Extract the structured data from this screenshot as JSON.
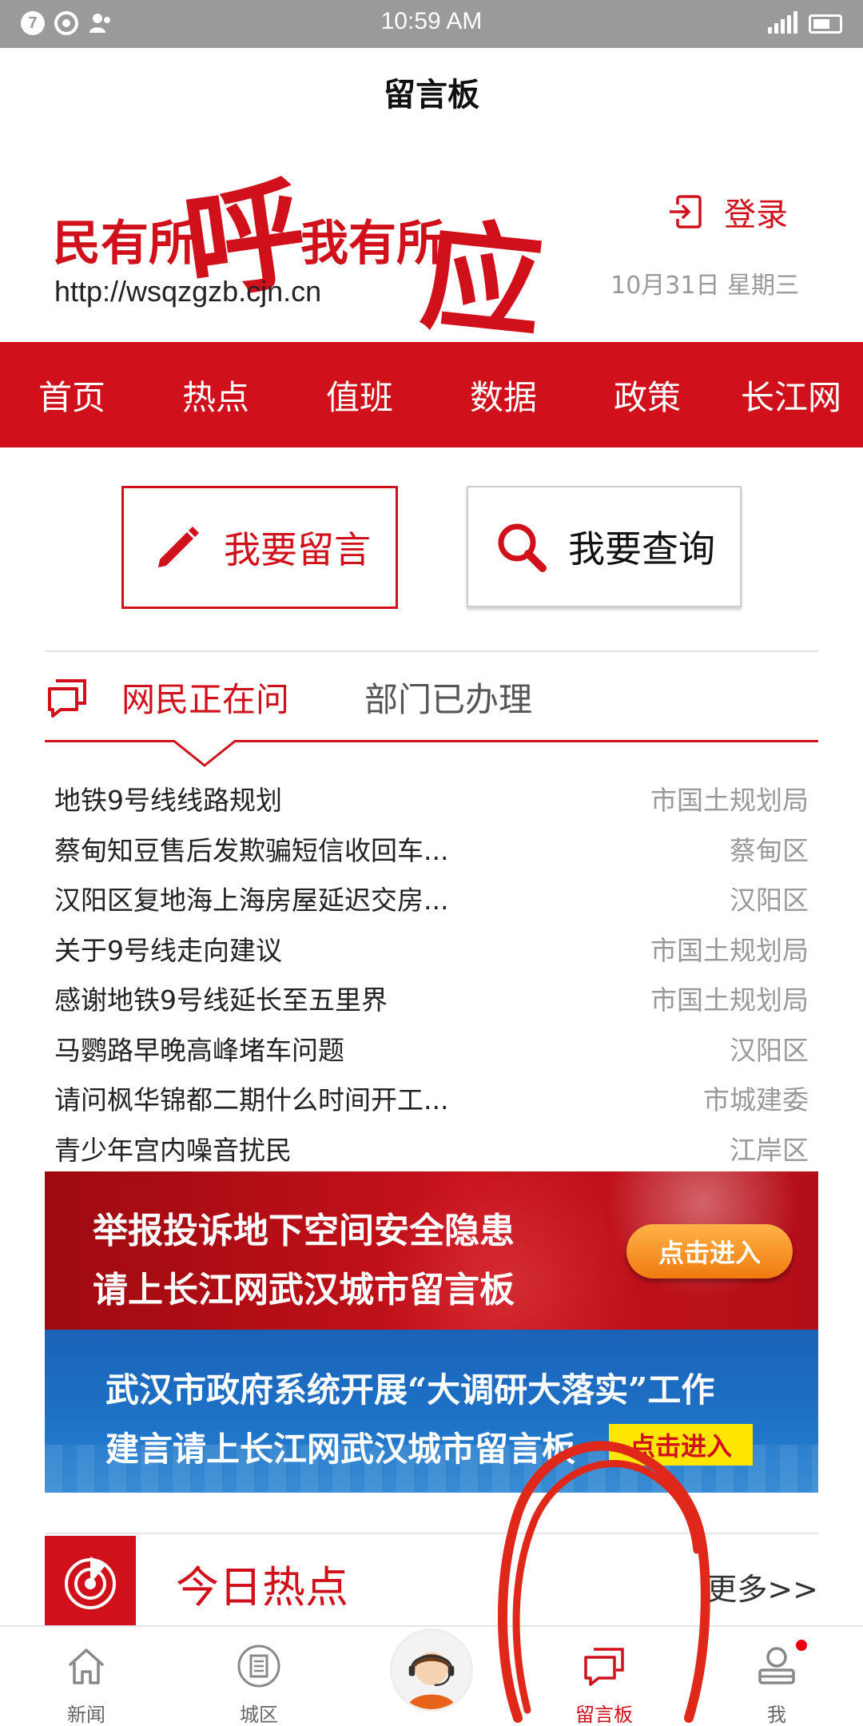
{
  "status_bar": {
    "time": "10:59 AM",
    "badge": "7"
  },
  "header": {
    "title": "留言板"
  },
  "logo": {
    "part1": "民有所",
    "big1": "呼",
    "part2": "我有所",
    "big2": "应",
    "url": "http://wsqzgzb.cjn.cn"
  },
  "login": {
    "label": "登录"
  },
  "date": "10月31日 星期三",
  "nav": {
    "items": [
      "首页",
      "热点",
      "值班",
      "数据",
      "政策",
      "长江网"
    ]
  },
  "actions": {
    "leave_message": "我要留言",
    "query": "我要查询"
  },
  "tabs": {
    "active": "网民正在问",
    "other": "部门已办理"
  },
  "list": [
    {
      "title": "地铁9号线线路规划",
      "dept": "市国土规划局"
    },
    {
      "title": "蔡甸知豆售后发欺骗短信收回车...",
      "dept": "蔡甸区"
    },
    {
      "title": "汉阳区复地海上海房屋延迟交房...",
      "dept": "汉阳区"
    },
    {
      "title": "关于9号线走向建议",
      "dept": "市国土规划局"
    },
    {
      "title": "感谢地铁9号线延长至五里界",
      "dept": "市国土规划局"
    },
    {
      "title": "马鹦路早晚高峰堵车问题",
      "dept": "汉阳区"
    },
    {
      "title": "请问枫华锦都二期什么时间开工...",
      "dept": "市城建委"
    },
    {
      "title": "青少年宫内噪音扰民",
      "dept": "江岸区"
    }
  ],
  "banners": {
    "red": {
      "line1": "举报投诉地下空间安全隐患",
      "line2": "请上长江网武汉城市留言板",
      "cta": "点击进入"
    },
    "blue": {
      "line1": "武汉市政府系统开展“大调研大落实”工作",
      "line2": "建言请上长江网武汉城市留言板",
      "cta": "点击进入"
    }
  },
  "hot": {
    "label": "今日热点",
    "more": "更多>>"
  },
  "tabbar": {
    "items": [
      {
        "label": "新闻",
        "icon": "home-icon"
      },
      {
        "label": "城区",
        "icon": "district-icon"
      },
      {
        "label": "",
        "icon": "customer-service-avatar"
      },
      {
        "label": "留言板",
        "icon": "message-board-icon"
      },
      {
        "label": "我",
        "icon": "profile-icon"
      }
    ],
    "active_index": 3
  },
  "colors": {
    "brand_red": "#d0111b",
    "muted_text": "#999999"
  }
}
